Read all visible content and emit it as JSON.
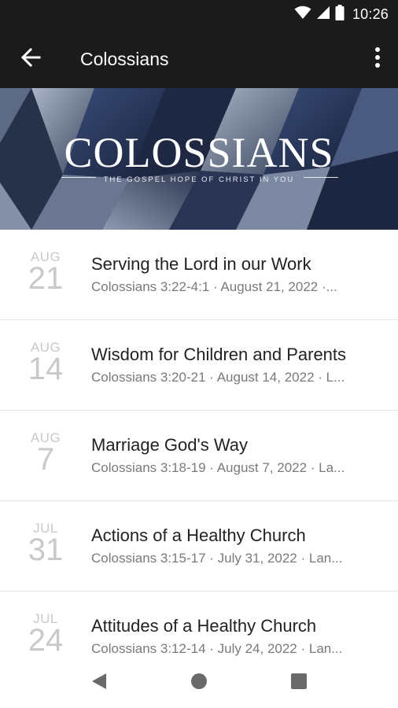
{
  "status_bar": {
    "time": "10:26",
    "icons": [
      "wifi-icon",
      "cell-signal-icon",
      "battery-icon"
    ]
  },
  "app_bar": {
    "title": "Colossians",
    "back_icon": "arrow-left-icon",
    "more_icon": "more-vertical-icon"
  },
  "banner": {
    "title": "COLOSSIANS",
    "subtitle": "THE GOSPEL HOPE OF CHRIST IN YOU"
  },
  "sermons": [
    {
      "month": "AUG",
      "day": "21",
      "title": "Serving the Lord in our Work",
      "meta": "Colossians 3:22-4:1 · August 21, 2022 ·..."
    },
    {
      "month": "AUG",
      "day": "14",
      "title": "Wisdom for Children and Parents",
      "meta": "Colossians 3:20-21 · August 14, 2022 · L..."
    },
    {
      "month": "AUG",
      "day": "7",
      "title": "Marriage God's Way",
      "meta": "Colossians 3:18-19 · August 7, 2022 · La..."
    },
    {
      "month": "JUL",
      "day": "31",
      "title": "Actions of a Healthy Church",
      "meta": "Colossians 3:15-17 · July 31, 2022 · Lan..."
    },
    {
      "month": "JUL",
      "day": "24",
      "title": "Attitudes of a Healthy Church",
      "meta": "Colossians 3:12-14 · July 24, 2022 · Lan..."
    }
  ],
  "nav_bar": {
    "icons": [
      "back-triangle-icon",
      "home-circle-icon",
      "recents-square-icon"
    ]
  },
  "colors": {
    "app_bar": "#1b1b1b",
    "banner_base": "#2a3448",
    "date_text": "#c9c9c9",
    "title_text": "#222222",
    "meta_text": "#7a7a7a"
  }
}
